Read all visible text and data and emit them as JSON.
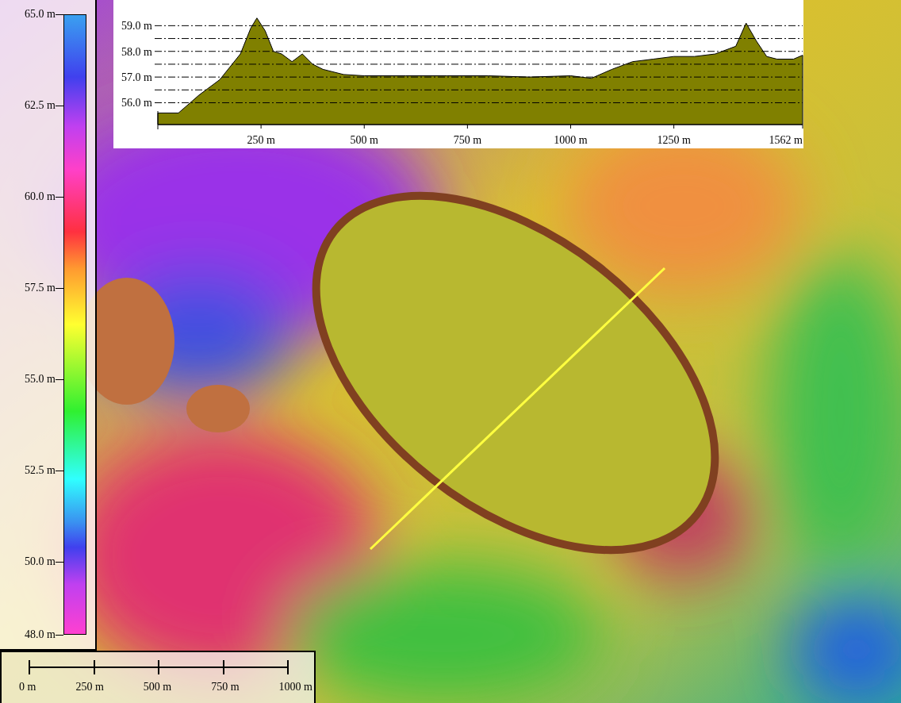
{
  "legend": {
    "labels": [
      "65.0 m",
      "62.5 m",
      "60.0 m",
      "57.5 m",
      "55.0 m",
      "52.5 m",
      "50.0 m",
      "48.0 m"
    ]
  },
  "profile": {
    "chart_data": {
      "type": "area",
      "x": [
        0,
        50,
        100,
        150,
        200,
        225,
        240,
        260,
        280,
        300,
        325,
        350,
        375,
        400,
        450,
        500,
        600,
        700,
        800,
        900,
        1000,
        1050,
        1100,
        1150,
        1200,
        1250,
        1300,
        1350,
        1400,
        1425,
        1450,
        1475,
        1500,
        1540,
        1562
      ],
      "series": [
        {
          "color": "#808000",
          "values": [
            55.6,
            55.6,
            56.3,
            56.9,
            57.9,
            58.9,
            59.3,
            58.8,
            58.0,
            57.9,
            57.6,
            57.9,
            57.5,
            57.3,
            57.1,
            57.05,
            57.05,
            57.05,
            57.05,
            57.0,
            57.05,
            56.95,
            57.3,
            57.6,
            57.7,
            57.8,
            57.8,
            57.9,
            58.2,
            59.1,
            58.4,
            57.8,
            57.7,
            57.7,
            57.85
          ]
        }
      ],
      "grid": true,
      "xlim": [
        0,
        1562
      ],
      "ylim": [
        55.15,
        60
      ],
      "xticks": [
        {
          "value": 250,
          "label": "250 m"
        },
        {
          "value": 500,
          "label": "500 m"
        },
        {
          "value": 750,
          "label": "750 m"
        },
        {
          "value": 1000,
          "label": "1000 m"
        },
        {
          "value": 1250,
          "label": "1250 m"
        },
        {
          "value": 1562,
          "label": "1562 m"
        }
      ],
      "yticks": [
        {
          "value": 56,
          "label": "56.0 m"
        },
        {
          "value": 57,
          "label": "57.0 m"
        },
        {
          "value": 58,
          "label": "58.0 m"
        },
        {
          "value": 59,
          "label": "59.0 m"
        }
      ]
    }
  },
  "scale_bar": {
    "labels": [
      "0 m",
      "250 m",
      "500 m",
      "750 m",
      "1000 m"
    ]
  }
}
